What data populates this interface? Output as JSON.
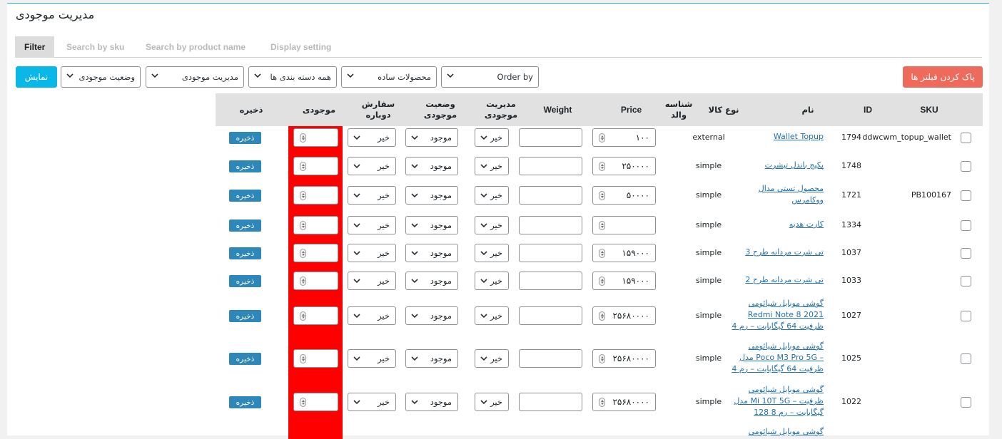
{
  "page": {
    "title": "مدیریت موجودی"
  },
  "tabs": [
    {
      "label": "Filter"
    },
    {
      "label": "Search by sku"
    },
    {
      "label": "Search by product name"
    },
    {
      "label": "Display setting"
    }
  ],
  "filters": {
    "show_button": "نمایش",
    "stock_status": "وضعیت موجودی",
    "manage_stock": "مدیریت موجودی",
    "category": "همه دسته بندی ها",
    "product_type": "محصولات ساده",
    "order_by": "Order by",
    "clear_button": "پاک کردن فیلتر ها"
  },
  "table": {
    "headers": {
      "sku": "SKU",
      "id": "ID",
      "name": "نام",
      "type": "نوع کالا",
      "parent_line1": "شناسه",
      "parent_line2": "والد",
      "price": "Price",
      "weight": "Weight",
      "manage_line1": "مدیریت",
      "manage_line2": "موجودی",
      "status_line1": "وضعیت",
      "status_line2": "موجودی",
      "backorder_line1": "سفارش",
      "backorder_line2": "دوباره",
      "stock": "موجودی",
      "save": "ذخیره"
    },
    "rows": [
      {
        "sku": "ddwcwm_topup_wallet",
        "id": "1794",
        "name_lines": [
          "Wallet Topup"
        ],
        "type": "external",
        "price": "۱۰۰",
        "manage": "خیر",
        "status": "موجود",
        "backorder": "خیر",
        "save": "ذخیره"
      },
      {
        "sku": "",
        "id": "1748",
        "name_lines": [
          "پکیج باندل تیشرت"
        ],
        "type": "simple",
        "price": "۲۵۰۰۰۰",
        "manage": "خیر",
        "status": "موجود",
        "backorder": "خیر",
        "save": "ذخیره"
      },
      {
        "sku": "PB100167",
        "id": "1721",
        "name_lines": [
          "محصول تستی مدال",
          "ووکامرس"
        ],
        "type": "simple",
        "price": "۵۰۰۰۰",
        "manage": "خیر",
        "status": "موجود",
        "backorder": "خیر",
        "save": "ذخیره"
      },
      {
        "sku": "",
        "id": "1334",
        "name_lines": [
          "کارت هدیه"
        ],
        "type": "simple",
        "price": "",
        "manage": "خیر",
        "status": "موجود",
        "backorder": "خیر",
        "save": "ذخیره"
      },
      {
        "sku": "",
        "id": "1037",
        "name_lines": [
          "تی شرت مردانه طرح 3"
        ],
        "type": "simple",
        "price": "۱۵۹۰۰۰",
        "manage": "خیر",
        "status": "موجود",
        "backorder": "خیر",
        "save": "ذخیره"
      },
      {
        "sku": "",
        "id": "1033",
        "name_lines": [
          "تی شرت مردانه طرح 2"
        ],
        "type": "simple",
        "price": "۱۵۹۰۰۰",
        "manage": "خیر",
        "status": "موجود",
        "backorder": "خیر",
        "save": "ذخیره"
      },
      {
        "sku": "",
        "id": "1027",
        "name_lines": [
          "گوشی موبایل شیائومی",
          "Redmi Note 8 2021",
          "ظرفیت 64 گیگابایت – رم 4"
        ],
        "type": "simple",
        "price": "۲۵۶۸۰۰۰۰",
        "manage": "خیر",
        "status": "موجود",
        "backorder": "خیر",
        "save": "ذخیره"
      },
      {
        "sku": "",
        "id": "1025",
        "name_lines": [
          "گوشی موبایل شیائومی",
          "مدل Poco M3 Pro 5G –",
          "ظرفیت 64 گیگابایت – رم 4"
        ],
        "type": "simple",
        "price": "۲۵۶۸۰۰۰۰",
        "manage": "خیر",
        "status": "موجود",
        "backorder": "خیر",
        "save": "ذخیره"
      },
      {
        "sku": "",
        "id": "1022",
        "name_lines": [
          "گوشی موبایل شیائومی",
          "مدل Mi 10T 5G – ظرفیت",
          "128 گیگابایت – رم 8"
        ],
        "type": "simple",
        "price": "۲۵۶۸۰۰۰۰",
        "manage": "خیر",
        "status": "موجود",
        "backorder": "خیر",
        "save": "ذخیره"
      },
      {
        "sku": "",
        "id": "",
        "name_lines": [
          "گوشی موبایل شیائومی"
        ],
        "type": "",
        "price": "",
        "manage": "",
        "status": "",
        "backorder": "",
        "save": ""
      }
    ]
  }
}
